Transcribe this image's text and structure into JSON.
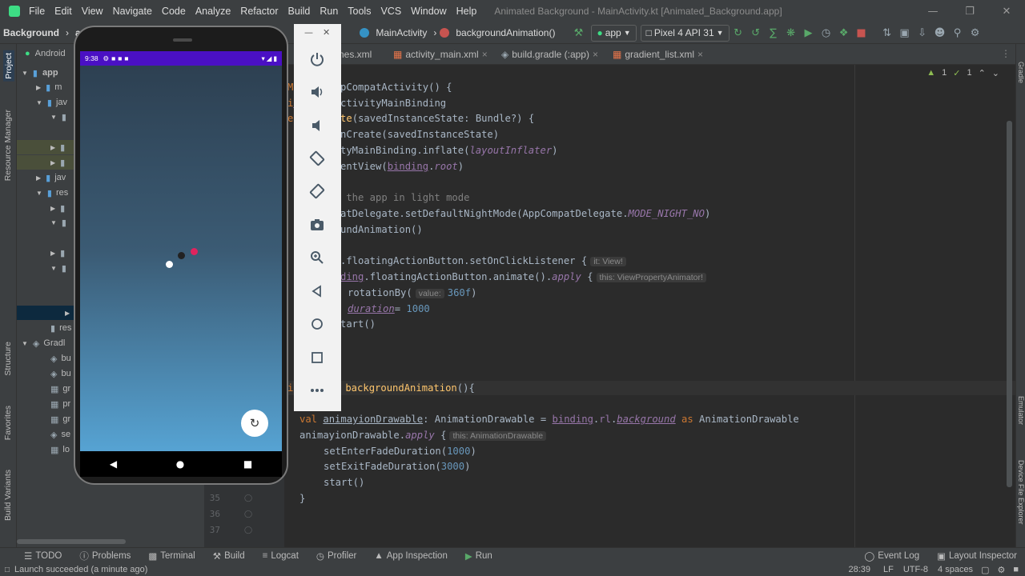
{
  "menu": [
    "File",
    "Edit",
    "View",
    "Navigate",
    "Code",
    "Analyze",
    "Refactor",
    "Build",
    "Run",
    "Tools",
    "VCS",
    "Window",
    "Help"
  ],
  "window_title": "Animated Background - MainActivity.kt [Animated_Background.app]",
  "breadcrumb": {
    "project": "Background",
    "module": "app",
    "class": "MainActivity",
    "method": "backgroundAnimation()"
  },
  "toolbar": {
    "config": "app",
    "device": "Pixel 4 API 31"
  },
  "tabs": [
    "nes.xml",
    "activity_main.xml",
    "build.gradle (:app)",
    "gradient_list.xml"
  ],
  "project_panel": {
    "header": "Android",
    "root": "app",
    "items": [
      "m",
      "jav",
      "",
      "",
      "",
      "jav",
      "res",
      "",
      "",
      "",
      "",
      "",
      "res",
      "Gradl",
      "bu",
      "bu",
      "gr",
      "pr",
      "gr",
      "se",
      "lo"
    ]
  },
  "left_tool_labels": {
    "project": "Project",
    "resource": "Resource Manager",
    "structure": "Structure",
    "favorites": "Favorites",
    "build_variants": "Build Variants"
  },
  "right_tool_labels": {
    "gradle": "Gradle",
    "emulator": "Emulator",
    "device_explorer": "Device File Explorer"
  },
  "inspection": {
    "warnings": "1",
    "ok": "1"
  },
  "code": {
    "l1": "ity : AppCompatActivity() {",
    "l2_a": "nding",
    "l2_b": ": ActivityMainBinding",
    "l3_a": "n ",
    "l3_b": "onCreate",
    "l3_c": "(savedInstanceState: Bundle?) {",
    "l4": "nCreate(savedInstanceState)",
    "l5_a": "tyMainBinding.inflate(",
    "l5_b": "layoutInflater",
    "l5_c": ")",
    "l6_a": "entView(",
    "l6_b": "binding",
    "l6_c": ".",
    "l6_d": "root",
    "l6_e": ")",
    "l7": " the app in light mode",
    "l8_a": "atDelegate.setDefaultNightMode(AppCompatDelegate.",
    "l8_b": "MODE_NIGHT_NO",
    "l8_c": ")",
    "l9": "undAnimation()",
    "l10": ".floatingActionButton.setOnClickListener {",
    "l10_hint": "it: View!",
    "l11_a": "ding",
    "l11_b": ".floatingActionButton.animate().",
    "l11_c": "apply",
    "l11_d": " {",
    "l11_hint": "this: ViewPropertyAnimator!",
    "l12_a": "rotationBy(",
    "l12_hint": "value:",
    "l12_b": "360f",
    "l12_c": ")",
    "l13_a": "duration",
    "l13_b": "= ",
    "l13_c": "1000",
    "l14": "tart()",
    "l15_a": "backgroundAnimation",
    "l15_b": "(){",
    "l16_a": "val ",
    "l16_b": "animayionDrawable",
    "l16_c": ": AnimationDrawable = ",
    "l16_d": "binding",
    "l16_e": ".",
    "l16_f": "rl",
    "l16_g": ".",
    "l16_h": "background",
    "l16_i": " as ",
    "l16_j": "AnimationDrawable",
    "l17_a": "animayionDrawable.",
    "l17_b": "apply",
    "l17_c": " {",
    "l17_hint": "this: AnimationDrawable",
    "l18_a": "setEnterFadeDuration(",
    "l18_b": "1000",
    "l18_c": ")",
    "l19_a": "setExitFadeDuration(",
    "l19_b": "3000",
    "l19_c": ")",
    "l20": "start()",
    "l21": "}",
    "l22": "}",
    "l23": "}"
  },
  "line_numbers": [
    "35",
    "36",
    "37"
  ],
  "phone": {
    "time": "9:38"
  },
  "bottom_tabs": [
    "TODO",
    "Problems",
    "Terminal",
    "Build",
    "Logcat",
    "Profiler",
    "App Inspection",
    "Run",
    "Event Log",
    "Layout Inspector"
  ],
  "status": {
    "message": "Launch succeeded (a minute ago)",
    "position": "28:39",
    "line_sep": "LF",
    "encoding": "UTF-8",
    "indent": "4 spaces"
  },
  "colors": {
    "status_bar": "#4a10c4",
    "accent_dot": "#e0245e",
    "keyword": "#cc7832",
    "function": "#ffc66d"
  }
}
